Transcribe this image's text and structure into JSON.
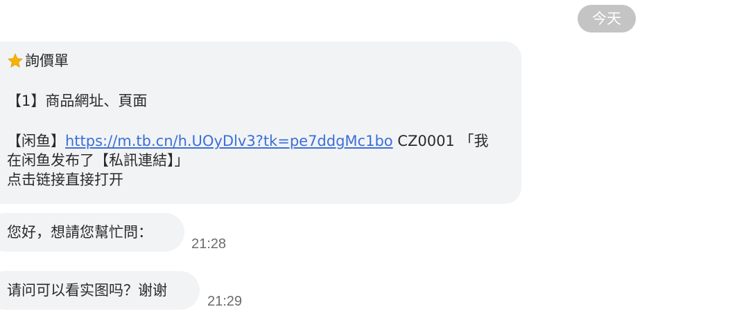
{
  "date_separator": "今天",
  "messages": [
    {
      "lines": {
        "title": "詢價單",
        "item": "【1】商品網址、頁面",
        "prefix": "【闲鱼】",
        "link": "https://m.tb.cn/h.UOyDlv3?tk=pe7ddgMc1bo",
        "after_link": " CZ0001 「我",
        "line4": "在闲鱼发布了【私訊連結】」",
        "line5": "点击链接直接打开"
      },
      "icon": "star-icon"
    },
    {
      "text": "您好，想請您幫忙問：",
      "time": "21:28"
    },
    {
      "text": "请问可以看实图吗？谢谢",
      "time": "21:29"
    }
  ],
  "colors": {
    "bubble": "#f2f3f5",
    "link": "#3a6fd8",
    "date_chip": "#c4c4c4",
    "star": "#f5b400"
  }
}
